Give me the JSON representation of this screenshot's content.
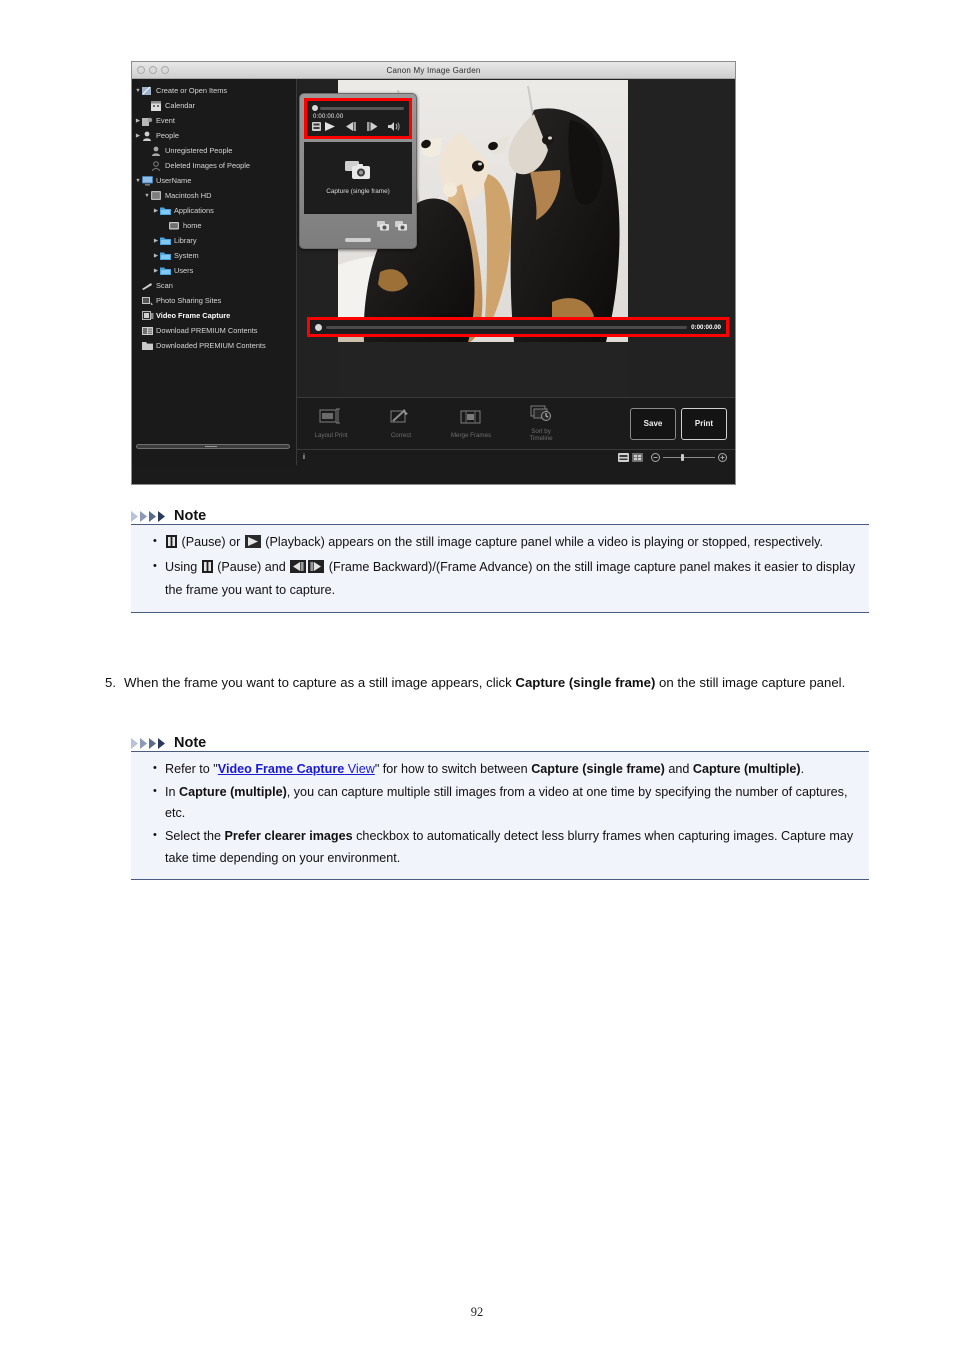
{
  "app": {
    "title": "Canon My Image Garden",
    "window_controls": [
      "close",
      "minimize",
      "zoom"
    ],
    "sidebar": {
      "items": [
        {
          "label": "Create or Open Items",
          "icon": "create-open-items-icon",
          "twisty": "down",
          "indent": 0,
          "bold": false
        },
        {
          "label": "Calendar",
          "icon": "calendar-icon",
          "twisty": "none",
          "indent": 1,
          "bold": false
        },
        {
          "label": "Event",
          "icon": "event-icon",
          "twisty": "right",
          "indent": 0,
          "bold": false
        },
        {
          "label": "People",
          "icon": "people-icon",
          "twisty": "right",
          "indent": 0,
          "bold": false
        },
        {
          "label": "Unregistered People",
          "icon": "unregistered-people-icon",
          "twisty": "none",
          "indent": 1,
          "bold": false
        },
        {
          "label": "Deleted Images of People",
          "icon": "deleted-people-icon",
          "twisty": "none",
          "indent": 1,
          "bold": false
        },
        {
          "label": "UserName",
          "icon": "computer-icon",
          "twisty": "down",
          "indent": 0,
          "bold": false
        },
        {
          "label": "Macintosh HD",
          "icon": "harddisk-icon",
          "twisty": "down",
          "indent": 1,
          "bold": false
        },
        {
          "label": "Applications",
          "icon": "folder-icon",
          "twisty": "right",
          "indent": 2,
          "bold": false
        },
        {
          "label": "home",
          "icon": "home-icon",
          "twisty": "none",
          "indent": 3,
          "bold": false
        },
        {
          "label": "Library",
          "icon": "folder-icon",
          "twisty": "right",
          "indent": 2,
          "bold": false
        },
        {
          "label": "System",
          "icon": "folder-icon",
          "twisty": "right",
          "indent": 2,
          "bold": false
        },
        {
          "label": "Users",
          "icon": "folder-icon",
          "twisty": "right",
          "indent": 2,
          "bold": false
        },
        {
          "label": "Scan",
          "icon": "scan-icon",
          "twisty": "none",
          "indent": 0,
          "bold": false
        },
        {
          "label": "Photo Sharing Sites",
          "icon": "photo-sharing-icon",
          "twisty": "none",
          "indent": 0,
          "bold": false
        },
        {
          "label": "Video Frame Capture",
          "icon": "video-frame-capture-icon",
          "twisty": "none",
          "indent": 0,
          "bold": true
        },
        {
          "label": "Download PREMIUM Contents",
          "icon": "download-premium-icon",
          "twisty": "none",
          "indent": 0,
          "bold": false
        },
        {
          "label": "Downloaded PREMIUM Contents",
          "icon": "downloaded-premium-icon",
          "twisty": "none",
          "indent": 0,
          "bold": false
        }
      ]
    },
    "capture_panel": {
      "timecode": "0:00:00.00",
      "controls": [
        "stop-button",
        "playback-button",
        "frame-backward-button",
        "frame-advance-button",
        "volume-button"
      ],
      "capture_label": "Capture (single frame)",
      "footer_icons": [
        "capture-multiple-icon",
        "capture-single-icon"
      ],
      "highlight_color": "#ff0000"
    },
    "timeline": {
      "timecode": "0:00:00.00",
      "highlight_color": "#ff0000"
    },
    "toolbar": {
      "tools": [
        {
          "label": "Layout Print",
          "icon": "layout-print-icon"
        },
        {
          "label": "Correct",
          "icon": "correct-icon"
        },
        {
          "label": "Merge Frames",
          "icon": "merge-frames-icon"
        },
        {
          "label": "Sort by\nTimeline",
          "icon": "sort-by-timeline-icon"
        }
      ],
      "save_label": "Save",
      "print_label": "Print"
    },
    "statusbar": {
      "info": "i",
      "view_icons": [
        "detail-view-icon",
        "thumbnail-view-icon"
      ],
      "zoom_out_icon": "zoom-out-icon",
      "zoom_in_icon": "zoom-in-icon"
    }
  },
  "note1": {
    "title": "Note",
    "bullets": [
      {
        "parts": [
          {
            "type": "icon",
            "name": "pause-icon"
          },
          {
            "type": "text",
            "text": " (Pause) or "
          },
          {
            "type": "icon",
            "name": "playback-icon"
          },
          {
            "type": "text",
            "text": " (Playback) appears on the still image capture panel while a video is playing or stopped, respectively."
          }
        ]
      },
      {
        "parts": [
          {
            "type": "text",
            "text": "Using "
          },
          {
            "type": "icon",
            "name": "pause-icon"
          },
          {
            "type": "text",
            "text": " (Pause) and "
          },
          {
            "type": "icon",
            "name": "frame-backward-icon"
          },
          {
            "type": "icon",
            "name": "frame-advance-icon"
          },
          {
            "type": "text",
            "text": " (Frame Backward)/(Frame Advance) on the still image capture panel makes it easier to display the frame you want to capture."
          }
        ]
      }
    ]
  },
  "step5": {
    "number": "5.",
    "text_before": "When the frame you want to capture as a still image appears, click ",
    "bold_term": "Capture (single frame)",
    "text_after": " on the still image capture panel."
  },
  "note2": {
    "title": "Note",
    "bullets": [
      {
        "parts": [
          {
            "type": "text",
            "text": "Refer to \""
          },
          {
            "type": "link-bold",
            "text": "Video Frame Capture"
          },
          {
            "type": "link",
            "text": " View"
          },
          {
            "type": "text",
            "text": "\" for how to switch between "
          },
          {
            "type": "bold",
            "text": "Capture (single frame)"
          },
          {
            "type": "text",
            "text": " and "
          },
          {
            "type": "bold",
            "text": "Capture (multiple)"
          },
          {
            "type": "text",
            "text": "."
          }
        ]
      },
      {
        "parts": [
          {
            "type": "text",
            "text": "In "
          },
          {
            "type": "bold",
            "text": "Capture (multiple)"
          },
          {
            "type": "text",
            "text": ", you can capture multiple still images from a video at one time by specifying the number of captures, etc."
          }
        ]
      },
      {
        "parts": [
          {
            "type": "text",
            "text": "Select the "
          },
          {
            "type": "bold",
            "text": "Prefer clearer images"
          },
          {
            "type": "text",
            "text": " checkbox to automatically detect less blurry frames when capturing images. Capture may take time depending on your environment."
          }
        ]
      }
    ]
  },
  "page": {
    "number": "92"
  },
  "colors": {
    "note_bg": "#f2f4fb",
    "note_rule": "#4a5a80",
    "link": "#1a1ad0",
    "highlight": "#ff0000",
    "app_bg": "#1b1b1b"
  }
}
